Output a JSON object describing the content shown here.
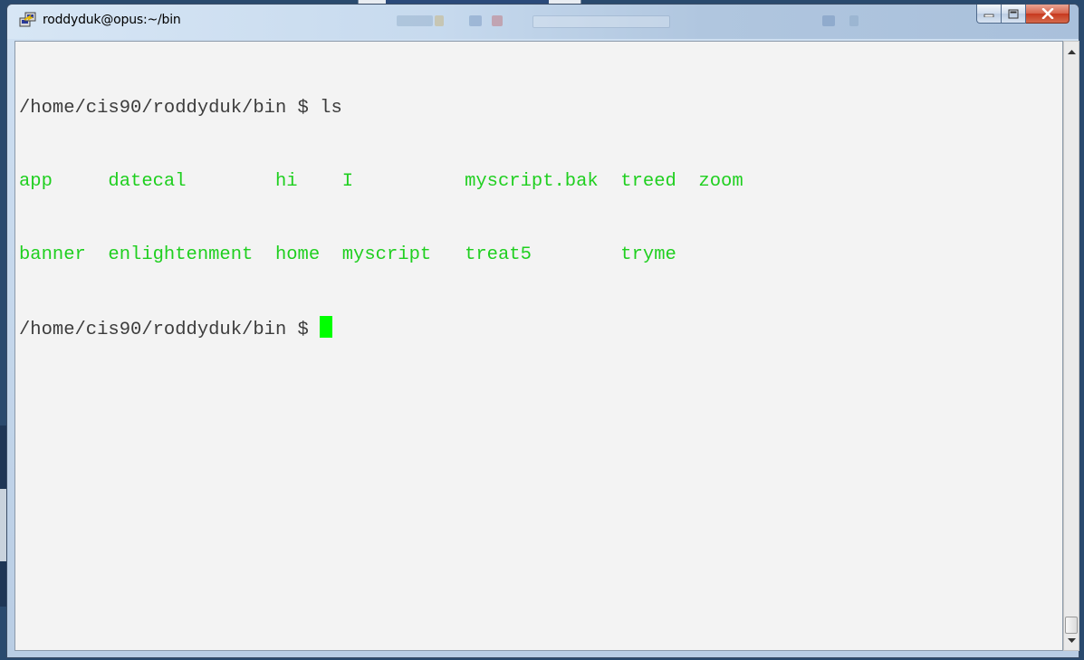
{
  "window": {
    "title": "roddyduk@opus:~/bin",
    "icon": "putty-icon",
    "buttons": {
      "minimize": "minimize-icon",
      "maximize": "maximize-icon",
      "close": "close-icon"
    }
  },
  "terminal": {
    "lines": [
      {
        "text": "/home/cis90/roddyduk/bin $ ls",
        "color": "#3c3c3c"
      },
      {
        "text": "app     datecal        hi    I          myscript.bak  treed  zoom",
        "color": "#1fcf1f"
      },
      {
        "text": "banner  enlightenment  home  myscript   treat5        tryme",
        "color": "#1fcf1f"
      },
      {
        "text": "/home/cis90/roddyduk/bin $ ",
        "color": "#3c3c3c"
      }
    ],
    "cursor_color": "#00ff00",
    "background": "#f3f3f3"
  },
  "scrollbar": {
    "up_icon": "scroll-up-arrow-icon",
    "down_icon": "scroll-down-arrow-icon"
  }
}
